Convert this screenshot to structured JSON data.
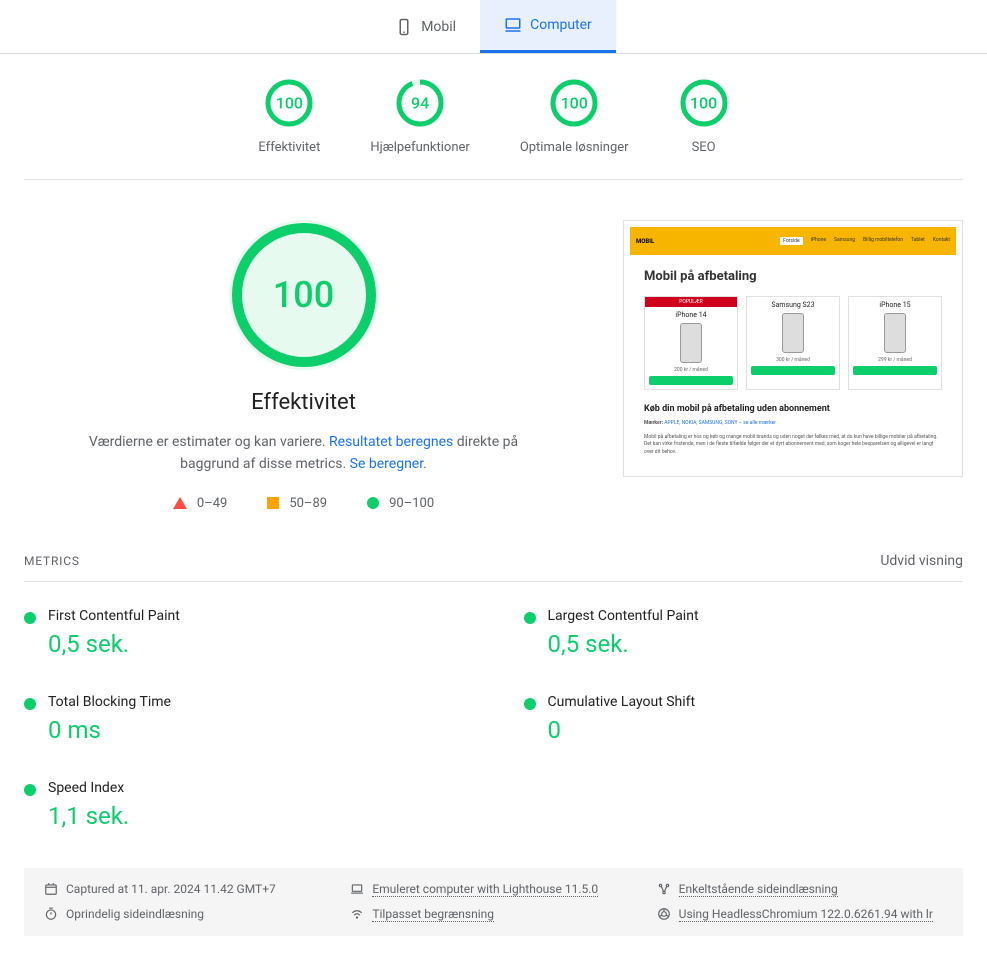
{
  "tabs": {
    "mobile": "Mobil",
    "computer": "Computer"
  },
  "scores": [
    {
      "value": "100",
      "pct": 100,
      "label": "Effektivitet"
    },
    {
      "value": "94",
      "pct": 94,
      "label": "Hjælpefunktioner"
    },
    {
      "value": "100",
      "pct": 100,
      "label": "Optimale løsninger"
    },
    {
      "value": "100",
      "pct": 100,
      "label": "SEO"
    }
  ],
  "big": {
    "value": "100",
    "title": "Effektivitet",
    "desc_pre": "Værdierne er estimater og kan variere. ",
    "link1": "Resultatet beregnes",
    "desc_mid": " direkte på baggrund af disse metrics. ",
    "link2": "Se beregner"
  },
  "legend": {
    "r1": "0–49",
    "r2": "50–89",
    "r3": "90–100"
  },
  "thumb": {
    "title": "Mobil på afbetaling",
    "pop": "POPULÆR",
    "cards": [
      "iPhone 14",
      "Samsung S23",
      "iPhone 15"
    ],
    "sub": "Køb din mobil på afbetaling uden abonnement",
    "brands_label": "Mærker:",
    "brands": "APPLE, NOKIA, SAMSUNG, SONY – se alle mærker"
  },
  "metrics_title": "METRICS",
  "expand": "Udvid visning",
  "metrics": [
    {
      "name": "First Contentful Paint",
      "value": "0,5 sek."
    },
    {
      "name": "Largest Contentful Paint",
      "value": "0,5 sek."
    },
    {
      "name": "Total Blocking Time",
      "value": "0 ms"
    },
    {
      "name": "Cumulative Layout Shift",
      "value": "0"
    },
    {
      "name": "Speed Index",
      "value": "1,1 sek."
    }
  ],
  "footer": {
    "captured": "Captured at 11. apr. 2024 11.42 GMT+7",
    "emulated": "Emuleret computer with Lighthouse 11.5.0",
    "single": "Enkeltstående sideindlæsning",
    "initial": "Oprindelig sideindlæsning",
    "throttle": "Tilpasset begrænsning",
    "chrome": "Using HeadlessChromium 122.0.6261.94 with lr"
  },
  "chart_data": {
    "type": "table",
    "title": "PageSpeed Insights – Computer",
    "scores": [
      {
        "category": "Effektivitet",
        "value": 100
      },
      {
        "category": "Hjælpefunktioner",
        "value": 94
      },
      {
        "category": "Optimale løsninger",
        "value": 100
      },
      {
        "category": "SEO",
        "value": 100
      }
    ],
    "performance_score": 100,
    "metrics": [
      {
        "name": "First Contentful Paint",
        "value_seconds": 0.5,
        "display": "0,5 sek.",
        "status": "good"
      },
      {
        "name": "Largest Contentful Paint",
        "value_seconds": 0.5,
        "display": "0,5 sek.",
        "status": "good"
      },
      {
        "name": "Total Blocking Time",
        "value_ms": 0,
        "display": "0 ms",
        "status": "good"
      },
      {
        "name": "Cumulative Layout Shift",
        "value": 0,
        "display": "0",
        "status": "good"
      },
      {
        "name": "Speed Index",
        "value_seconds": 1.1,
        "display": "1,1 sek.",
        "status": "good"
      }
    ],
    "score_ranges": [
      {
        "label": "0–49",
        "color": "#ff4e42"
      },
      {
        "label": "50–89",
        "color": "#ffa400"
      },
      {
        "label": "90–100",
        "color": "#0cce6b"
      }
    ]
  }
}
